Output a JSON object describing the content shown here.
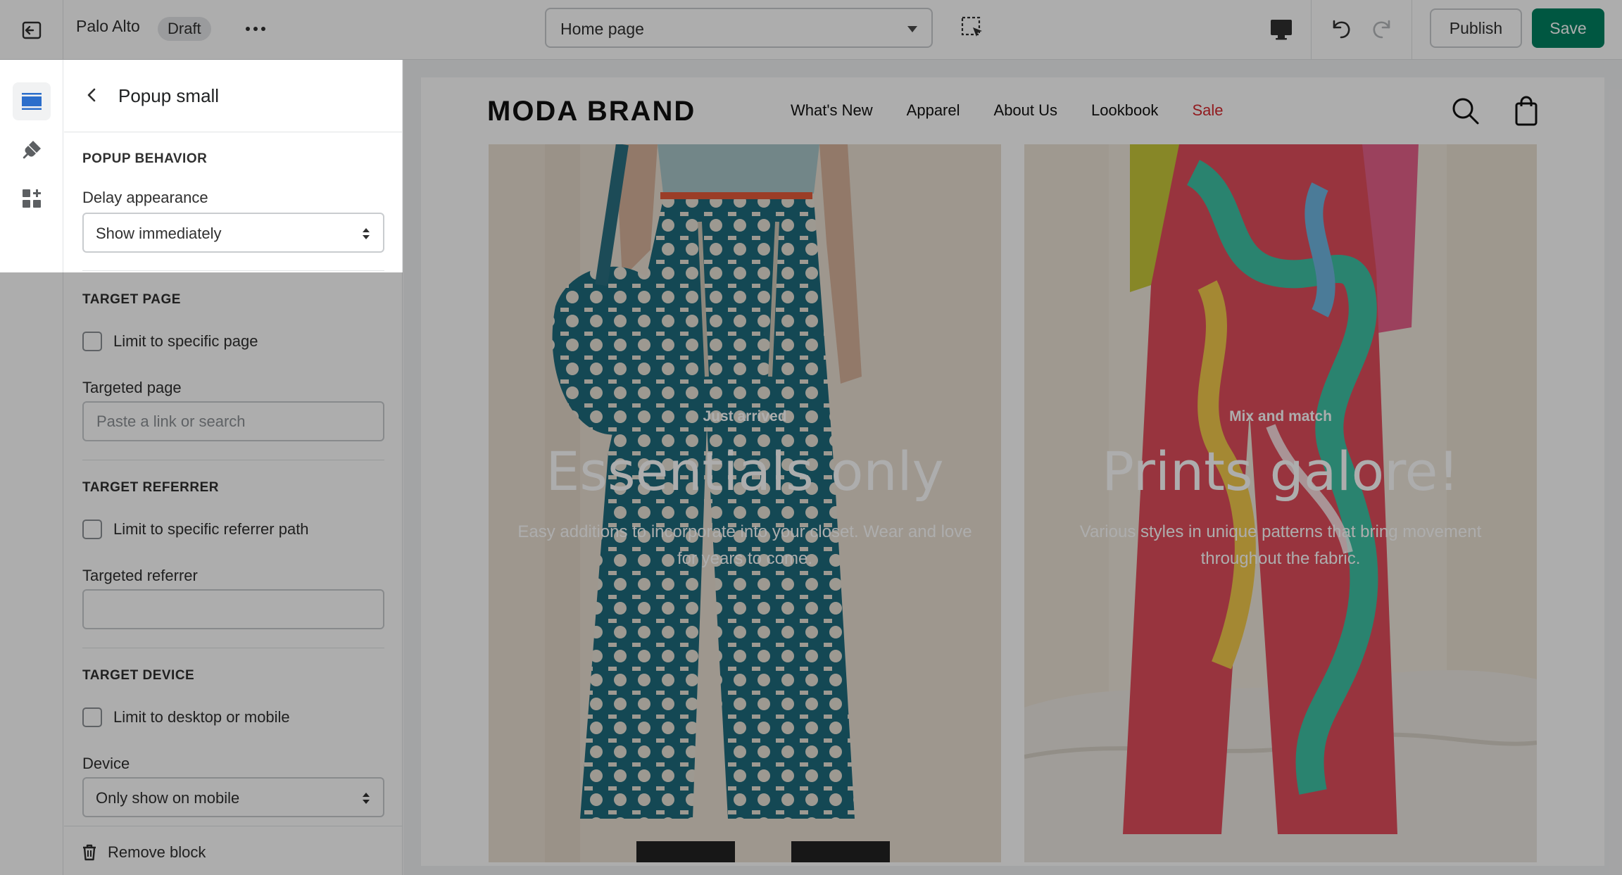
{
  "topbar": {
    "store_name": "Palo Alto",
    "status_badge": "Draft",
    "page_selector": "Home page",
    "publish_label": "Publish",
    "save_label": "Save"
  },
  "rail": {
    "items": [
      {
        "icon": "sections-icon",
        "active": true
      },
      {
        "icon": "theme-settings-icon",
        "active": false
      },
      {
        "icon": "app-embeds-icon",
        "active": false
      }
    ]
  },
  "panel": {
    "title": "Popup small",
    "popup_behavior": {
      "heading": "POPUP BEHAVIOR",
      "delay_label": "Delay appearance",
      "delay_value": "Show immediately"
    },
    "target_page": {
      "heading": "TARGET PAGE",
      "checkbox_label": "Limit to specific page",
      "field_label": "Targeted page",
      "placeholder": "Paste a link or search"
    },
    "target_referrer": {
      "heading": "TARGET REFERRER",
      "checkbox_label": "Limit to specific referrer path",
      "field_label": "Targeted referrer",
      "value": ""
    },
    "target_device": {
      "heading": "TARGET DEVICE",
      "checkbox_label": "Limit to desktop or mobile",
      "field_label": "Device",
      "device_value": "Only show on mobile"
    },
    "remove_label": "Remove block"
  },
  "preview": {
    "brand": "MODA BRAND",
    "nav": [
      "What's New",
      "Apparel",
      "About Us",
      "Lookbook",
      "Sale"
    ],
    "heroes": [
      {
        "eyebrow": "Just arrived",
        "title": "Essentials only",
        "description": "Easy additions to incorporate into your closet. Wear and love for years to come."
      },
      {
        "eyebrow": "Mix and match",
        "title": "Prints galore!",
        "description": "Various styles in unique patterns that bring movement throughout the fabric."
      }
    ]
  },
  "colors": {
    "primary": "#008060",
    "sale": "#d6292f",
    "overlay": "rgba(0,0,0,0.32)"
  }
}
